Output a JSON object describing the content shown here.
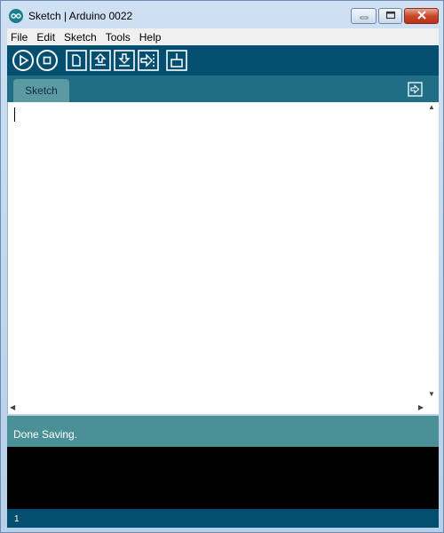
{
  "window": {
    "title": "Sketch | Arduino 0022",
    "app_icon": "arduino-logo-icon",
    "controls": [
      "minimize-icon",
      "maximize-icon",
      "close-icon"
    ]
  },
  "menubar": {
    "items": [
      {
        "label": "File"
      },
      {
        "label": "Edit"
      },
      {
        "label": "Sketch"
      },
      {
        "label": "Tools"
      },
      {
        "label": "Help"
      }
    ]
  },
  "toolbar": {
    "buttons": [
      "verify-icon",
      "stop-icon",
      "new-icon",
      "open-icon",
      "save-icon",
      "upload-icon",
      "serial-monitor-icon"
    ]
  },
  "tabs": {
    "items": [
      {
        "label": "Sketch"
      }
    ],
    "menu_icon": "tab-menu-icon"
  },
  "editor": {
    "content": ""
  },
  "status": {
    "message": "Done Saving."
  },
  "console": {
    "content": ""
  },
  "footer": {
    "line_number": "1"
  },
  "colors": {
    "toolbar": "#044f6f",
    "tabbar": "#1f6e86",
    "tab": "#5c9aa3",
    "status": "#4b8f97",
    "console": "#000000"
  }
}
